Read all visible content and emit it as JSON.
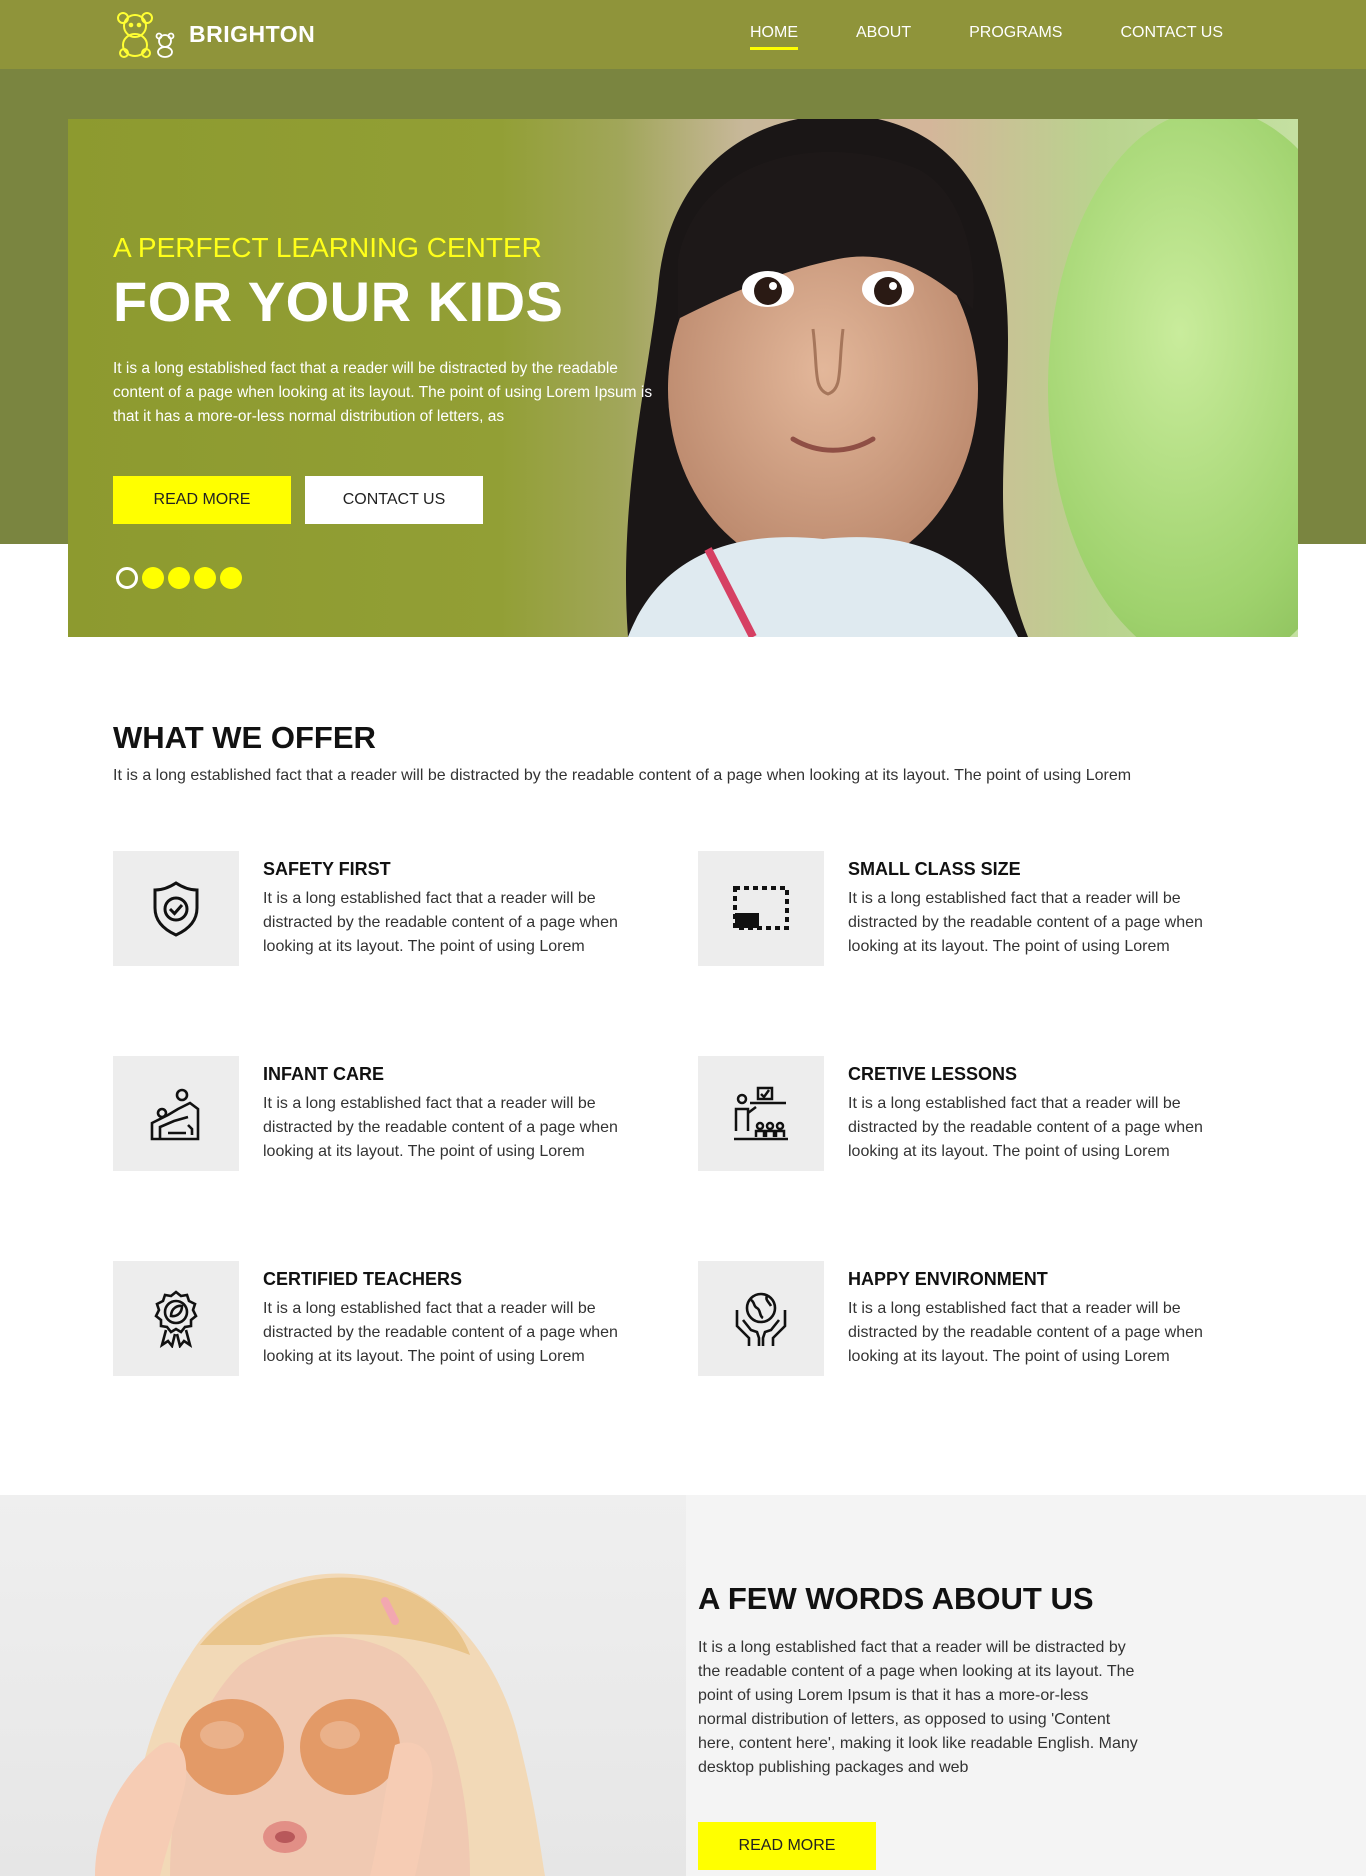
{
  "header": {
    "brand": "BRIGHTON",
    "nav": [
      "HOME",
      "ABOUT",
      "PROGRAMS",
      "CONTACT US"
    ],
    "active_index": 0,
    "bg_color": "#8f943a",
    "accent_color": "#ffff00"
  },
  "hero": {
    "subtitle": "A PERFECT LEARNING CENTER",
    "title": "FOR YOUR KIDS",
    "text": "It is a long established fact that a reader will be distracted by the readable content of a page when looking at its layout. The point of using Lorem Ipsum is that it has a more-or-less normal distribution of letters, as",
    "read_more": "READ MORE",
    "contact": "CONTACT US",
    "slide_count": 5,
    "active_slide": 0
  },
  "offer": {
    "title": "WHAT WE OFFER",
    "desc": "It is a long established fact that a reader will be distracted by the readable content of a page when looking at its layout. The point of using Lorem",
    "features": [
      {
        "title": "SAFETY FIRST",
        "icon": "shield-check-icon",
        "text": "It is a long established fact that a reader will be distracted by the readable content of a page when looking at its layout. The point of using Lorem"
      },
      {
        "title": "SMALL CLASS SIZE",
        "icon": "small-class-size-icon",
        "text": "It is a long established fact that a reader will be distracted by the readable content of a page when looking at its layout. The point of using Lorem"
      },
      {
        "title": "INFANT CARE",
        "icon": "infant-care-icon",
        "text": "It is a long established fact that a reader will be distracted by the readable content of a page when looking at its layout. The point of using Lorem"
      },
      {
        "title": "CRETIVE LESSONS",
        "icon": "teacher-lesson-icon",
        "text": "It is a long established fact that a reader will be distracted by the readable content of a page when looking at its layout. The point of using Lorem"
      },
      {
        "title": "CERTIFIED TEACHERS",
        "icon": "certified-badge-icon",
        "text": "It is a long established fact that a reader will be distracted by the readable content of a page when looking at its layout. The point of using Lorem"
      },
      {
        "title": "HAPPY ENVIRONMENT",
        "icon": "earth-hands-icon",
        "text": "It is a long established fact that a reader will be distracted by the readable content of a page when looking at its layout. The point of using Lorem"
      }
    ]
  },
  "about": {
    "title": "A FEW WORDS ABOUT US",
    "text": "It is a long established fact that a reader will be distracted by the readable content of a page when looking at its layout. The point of using Lorem Ipsum is that it has a more-or-less normal distribution of letters, as opposed to using 'Content here, content here', making it look like readable English. Many desktop publishing packages and web",
    "read_more": "READ MORE"
  }
}
